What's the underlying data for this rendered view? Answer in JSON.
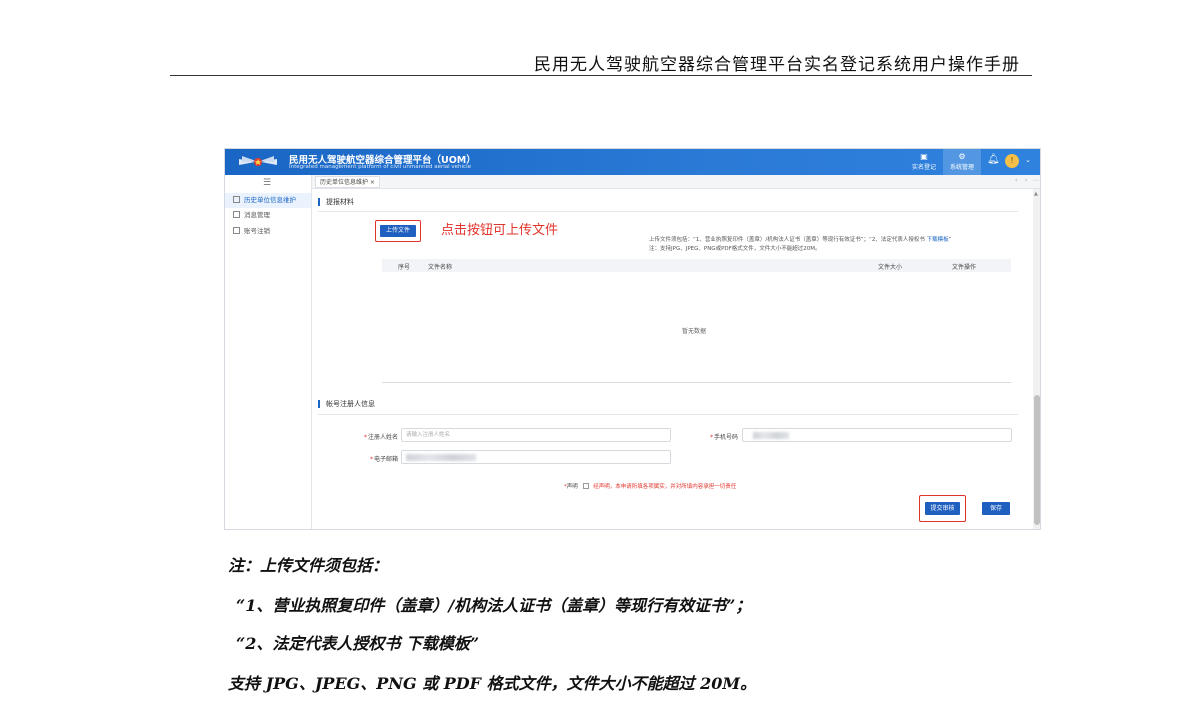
{
  "doc_header": {
    "title": "民用无人驾驶航空器综合管理平台实名登记系统用户操作手册"
  },
  "app": {
    "title": "民用无人驾驶航空器综合管理平台（UOM）",
    "subtitle": "Integrated management platform of civil unmanned aerial vehicle",
    "top_buttons": [
      {
        "label": "实名登记",
        "icon": "register-icon"
      },
      {
        "label": "系统管理",
        "icon": "settings-icon"
      }
    ],
    "avatar_initial": "!"
  },
  "sidebar": {
    "items": [
      {
        "label": "历史单位信息维护",
        "active": true
      },
      {
        "label": "消息管理",
        "active": false
      },
      {
        "label": "账号注销",
        "active": false
      }
    ]
  },
  "tabs": [
    {
      "label": "历史单位信息维护 ×"
    }
  ],
  "tab_nav": {
    "prev": "‹",
    "next": "›",
    "more": "⋯"
  },
  "materials": {
    "section_title": "提报材料",
    "upload_button": "上传文件",
    "callout": "点击按钮可上传文件",
    "note_line1": "上传文件须包括：“1、营业执照复印件（盖章）/机构法人证书（盖章）等现行有效证书”；“2、法定代表人授权书 ",
    "note_link": "下载模板",
    "note_line1_end": "”",
    "note_line2": "注：支持JPG、JPEG、PNG或PDF格式文件，文件大小不能超过20M。",
    "table": {
      "columns": [
        "序号",
        "文件名称",
        "文件大小",
        "文件操作"
      ],
      "empty_text": "暂无数据"
    }
  },
  "registrant": {
    "section_title": "帐号注册人信息",
    "name_label": "注册人姓名",
    "name_placeholder": "请输入注册人姓名",
    "phone_label": "手机号码",
    "email_label": "电子邮箱",
    "required_mark": "*"
  },
  "declaration": {
    "label": "声明",
    "required_mark": "*",
    "text": "经声明，本申请所填各项属实，并对所填内容承担一切责任"
  },
  "actions": {
    "submit": "提交审核",
    "save": "保存"
  },
  "notes": [
    "注：上传文件须包括：",
    "“1、营业执照复印件（盖章）/机构法人证书（盖章）等现行有效证书”；",
    "“2、法定代表人授权书 下载模板”",
    "支持 JPG、JPEG、PNG 或 PDF 格式文件，文件大小不能超过 20M。"
  ],
  "colors": {
    "primary": "#1f5fbf",
    "header_gradient": "#2a7ad6",
    "highlight_red": "#e0332b"
  }
}
